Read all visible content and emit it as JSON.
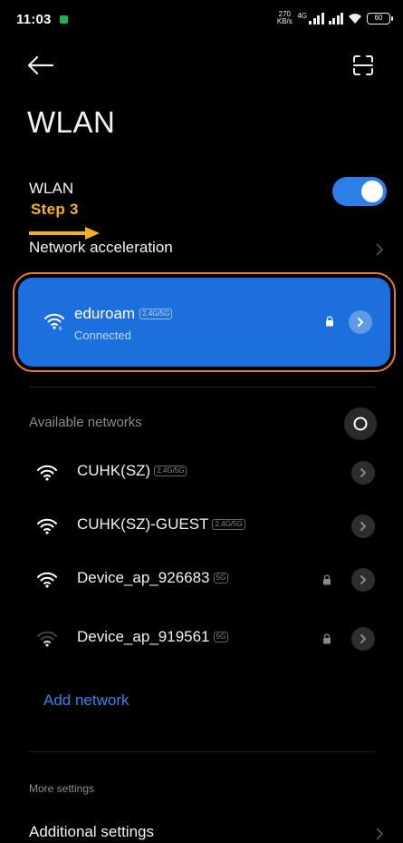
{
  "status_bar": {
    "time": "11:03",
    "network_speed": "270 KB/s",
    "signal_tag": "4G",
    "battery": "60"
  },
  "header": {
    "back_icon": "arrow-left-icon",
    "scan_icon": "qr-scan-icon",
    "title": "WLAN"
  },
  "wlan_toggle": {
    "label": "WLAN",
    "enabled": true,
    "color": "#2c7fe8"
  },
  "annotation": {
    "text": "Step 3",
    "color": "#f6b21a"
  },
  "network_acceleration": {
    "label": "Network acceleration"
  },
  "connected_network": {
    "name": "eduroam",
    "band": "2.4G/5G",
    "status": "Connected",
    "card_color": "#1c6fdc",
    "highlight_color": "#e47c2f",
    "secured": true
  },
  "available_networks": {
    "header": "Available networks",
    "items": [
      {
        "name": "CUHK(SZ)",
        "band": "2.4G/5G",
        "secured": false,
        "signal": "strong"
      },
      {
        "name": "CUHK(SZ)-GUEST",
        "band": "2.4G/5G",
        "secured": false,
        "signal": "strong"
      },
      {
        "name": "Device_ap_926683",
        "band": "5G",
        "secured": true,
        "signal": "strong"
      },
      {
        "name": "Device_ap_919561",
        "band": "5G",
        "secured": true,
        "signal": "weak"
      }
    ],
    "add_network_label": "Add network",
    "add_network_color": "#2f84ef"
  },
  "more_settings": {
    "header": "More settings",
    "additional_settings_label": "Additional settings"
  }
}
